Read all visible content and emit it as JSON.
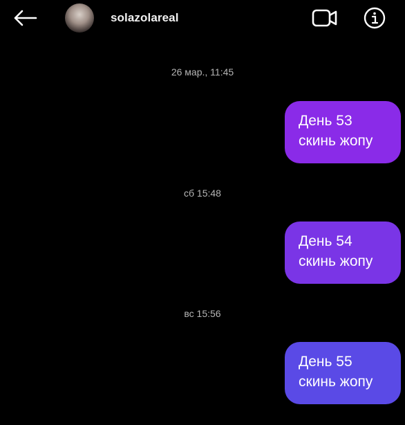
{
  "header": {
    "username": "solazolareal",
    "back_icon": "back-arrow-icon",
    "video_icon": "video-camera-icon",
    "info_icon": "info-icon"
  },
  "messages": [
    {
      "timestamp": "26 мар., 11:45",
      "line1": "День 53",
      "line2": "скинь жопу",
      "color": "#8a2be8"
    },
    {
      "timestamp": "сб 15:48",
      "line1": "День 54",
      "line2": "скинь жопу",
      "color": "#7a35e6"
    },
    {
      "timestamp": "вс 15:56",
      "line1": "День 55",
      "line2": "скинь жопу",
      "color": "#5a4ae6"
    }
  ]
}
